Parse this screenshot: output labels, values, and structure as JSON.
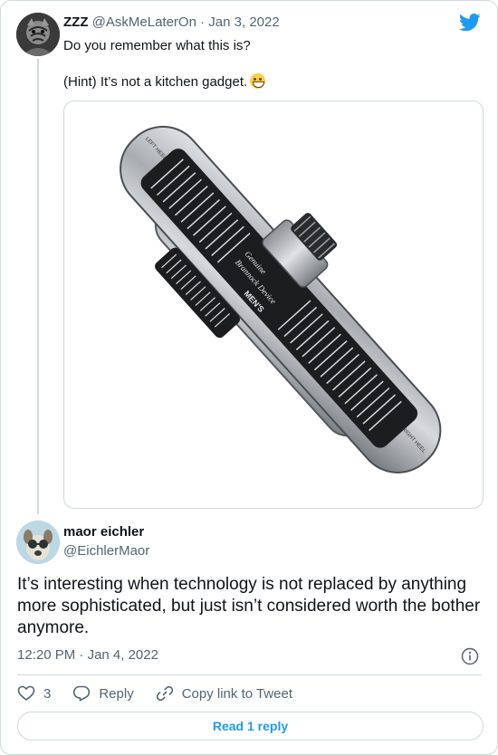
{
  "colors": {
    "accent": "#1d9bf0",
    "muted": "#536471",
    "border": "#cfd9de",
    "text": "#0f1419"
  },
  "parent_tweet": {
    "author_name": "ZZZ",
    "author_handle": "@AskMeLaterOn",
    "separator": "·",
    "date": "Jan 3, 2022",
    "line1": "Do you remember what this is?",
    "line2": "(Hint) It’s not a kitchen gadget.",
    "emoji": "grinning-face-emoji",
    "media_text": {
      "left_heel": "LEFT HEEL",
      "right_heel": "RIGHT HEEL",
      "mens": "MEN'S",
      "genuine": "Genuine",
      "brand": "Brannock Device"
    }
  },
  "reply_tweet": {
    "author_name": "maor eichler",
    "author_handle": "@EichlerMaor",
    "text": "It’s interesting when technology is not replaced by anything more sophisticated, but just isn’t considered worth the bother anymore.",
    "time": "12:20 PM",
    "separator": "·",
    "date": "Jan 4, 2022"
  },
  "actions": {
    "like_count": "3",
    "reply_label": "Reply",
    "copy_link_label": "Copy link to Tweet"
  },
  "read_replies_label": "Read 1 reply",
  "icons": [
    "twitter-logo-icon",
    "heart-icon",
    "reply-icon",
    "link-icon",
    "info-icon"
  ]
}
